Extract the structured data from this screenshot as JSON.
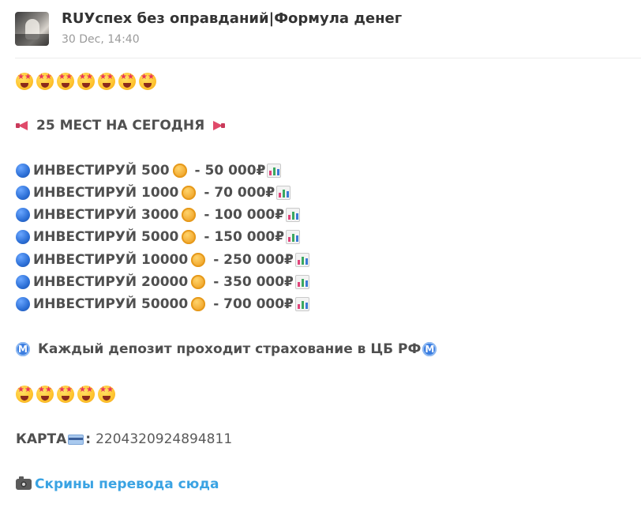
{
  "channel": {
    "title": "RUУспех без оправданий|Формула денег",
    "date": "30 Dec, 14:40"
  },
  "post": {
    "headline": "25 МЕСТ НА СЕГОДНЯ",
    "invest_rows": [
      {
        "label": "ИНВЕСТИРУЙ 500",
        "return": "- 50 000₽"
      },
      {
        "label": "ИНВЕСТИРУЙ 1000",
        "return": "- 70 000₽"
      },
      {
        "label": "ИНВЕСТИРУЙ 3000",
        "return": "- 100 000₽"
      },
      {
        "label": "ИНВЕСТИРУЙ 5000",
        "return": "- 150 000₽"
      },
      {
        "label": "ИНВЕСТИРУЙ 10000",
        "return": "- 250 000₽"
      },
      {
        "label": "ИНВЕСТИРУЙ 20000",
        "return": "- 350 000₽"
      },
      {
        "label": "ИНВЕСТИРУЙ 50000",
        "return": "- 700 000₽"
      }
    ],
    "insurance_text": "Каждый депозит проходит страхование в ЦБ РФ",
    "metro_letter": "M",
    "card_label": "КАРТА",
    "card_colon": ":",
    "card_number": "2204320924894811",
    "screenshots_link": "Скрины перевода сюда"
  },
  "icons": {
    "emoji_top": "star-struck",
    "emoji_bottom": "star-struck",
    "bullet": "blue-circle",
    "coin": "coin",
    "chart": "bar-chart",
    "megaphone": "megaphone",
    "metro": "metro",
    "card": "credit-card",
    "camera": "camera"
  },
  "colors": {
    "link": "#3aa3e3",
    "text": "#4f4f4f",
    "date": "#9a9a9a"
  }
}
